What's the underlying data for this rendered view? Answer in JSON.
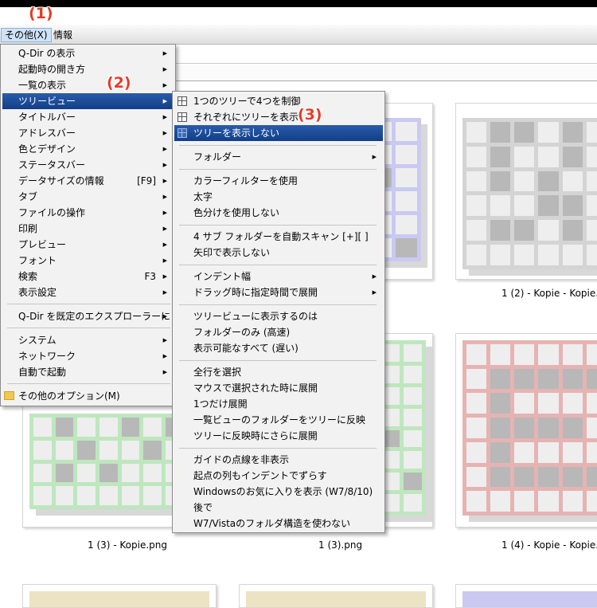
{
  "menubar": {
    "items": [
      "その他(X)",
      "情報"
    ]
  },
  "step_labels": [
    "(1)",
    "(2)",
    "(3)"
  ],
  "menu1": {
    "items": [
      {
        "label": "Q-Dir の表示",
        "submenu": true
      },
      {
        "label": "起動時の開き方",
        "submenu": true
      },
      {
        "label": "一覧の表示",
        "submenu": true
      },
      {
        "label": "ツリービュー",
        "submenu": true,
        "selected": true
      },
      {
        "label": "タイトルバー",
        "submenu": true
      },
      {
        "label": "アドレスバー",
        "submenu": true
      },
      {
        "label": "色とデザイン",
        "submenu": true
      },
      {
        "label": "ステータスバー",
        "submenu": true
      },
      {
        "label": "データサイズの情報",
        "shortcut": "[F9]",
        "submenu": true
      },
      {
        "label": "タブ",
        "submenu": true
      },
      {
        "label": "ファイルの操作",
        "submenu": true
      },
      {
        "label": "印刷",
        "submenu": true
      },
      {
        "label": "プレビュー",
        "submenu": true
      },
      {
        "label": "フォント",
        "submenu": true
      },
      {
        "label": "検索",
        "shortcut": "F3",
        "submenu": true
      },
      {
        "label": "表示設定",
        "submenu": true
      },
      {
        "label": "Q-Dir を既定のエクスプローラーに",
        "submenu": true
      },
      {
        "label": "システム",
        "submenu": true
      },
      {
        "label": "ネットワーク",
        "submenu": true
      },
      {
        "label": "自動で起動",
        "submenu": true
      },
      {
        "label": "その他のオプション(M)",
        "icon": "folder-icon"
      }
    ]
  },
  "menu2": {
    "items": [
      {
        "label": "1つのツリーで4つを制御",
        "icon": "layout-grid-icon"
      },
      {
        "label": "それぞれにツリーを表示",
        "icon": "layout-grid-icon"
      },
      {
        "label": "ツリーを表示しない",
        "icon": "layout-grid-icon",
        "selected": true
      },
      {
        "label": "フォルダー",
        "submenu": true
      },
      {
        "label": "カラーフィルターを使用"
      },
      {
        "label": "太字"
      },
      {
        "label": "色分けを使用しない"
      },
      {
        "label": "4 サブ フォルダーを自動スキャン [+][ ]"
      },
      {
        "label": "矢印で表示しない"
      },
      {
        "label": "インデント幅",
        "submenu": true
      },
      {
        "label": "ドラッグ時に指定時間で展開",
        "submenu": true
      },
      {
        "label": "ツリービューに表示するのは"
      },
      {
        "label": "フォルダーのみ (高速)"
      },
      {
        "label": "表示可能なすべて (遅い)"
      },
      {
        "label": "全行を選択"
      },
      {
        "label": "マウスで選択された時に展開"
      },
      {
        "label": "1つだけ展開"
      },
      {
        "label": "一覧ビューのフォルダーをツリーに反映"
      },
      {
        "label": "ツリーに反映時にさらに展開"
      },
      {
        "label": "ガイドの点線を非表示"
      },
      {
        "label": "起点の列もインデントでずらす"
      },
      {
        "label": "Windowsのお気に入りを表示 (W7/8/10)"
      },
      {
        "label": "後で"
      },
      {
        "label": "W7/Vistaのフォルダ構造を使わない"
      }
    ]
  },
  "files": [
    "1 (2) - Kopie - Kopie.png",
    "1 (3) - Kopie.png",
    "1 (3).png",
    "1 (4) - Kopie - Kopie.png"
  ],
  "colors": {
    "accent": "#1a4a96",
    "step_label": "#e53b25",
    "thumb_blue": "#c9c9f2",
    "thumb_gray": "#d4d4d4",
    "thumb_green": "#bfe6bf",
    "thumb_red": "#e6b3b3",
    "thumb_yellow": "#ece3c2"
  }
}
